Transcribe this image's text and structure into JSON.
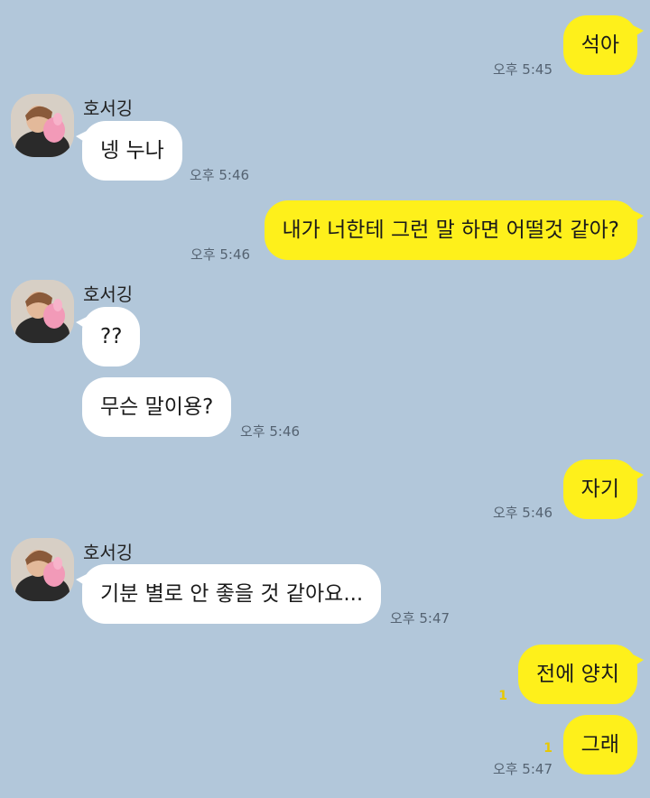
{
  "contact": {
    "name": "호서깅"
  },
  "messages": [
    {
      "from": "me",
      "text": "석아",
      "time": "오후 5:45"
    },
    {
      "from": "them",
      "text": "넹 누나",
      "time": "오후 5:46"
    },
    {
      "from": "me",
      "text": "내가 너한테 그런 말 하면 어떨것 같아?",
      "time": "오후 5:46"
    },
    {
      "from": "them",
      "text": "??"
    },
    {
      "from": "them",
      "text": "무슨 말이용?",
      "time": "오후 5:46"
    },
    {
      "from": "me",
      "text": "자기",
      "time": "오후 5:46"
    },
    {
      "from": "them",
      "text": "기분 별로 안 좋을 것 같아요...",
      "time": "오후 5:47"
    },
    {
      "from": "me",
      "text": "전에 양치",
      "unread": "1"
    },
    {
      "from": "me",
      "text": "그래",
      "unread": "1",
      "time": "오후 5:47"
    }
  ],
  "colors": {
    "background": "#b2c7da",
    "my_bubble": "#fef01b",
    "their_bubble": "#ffffff"
  }
}
